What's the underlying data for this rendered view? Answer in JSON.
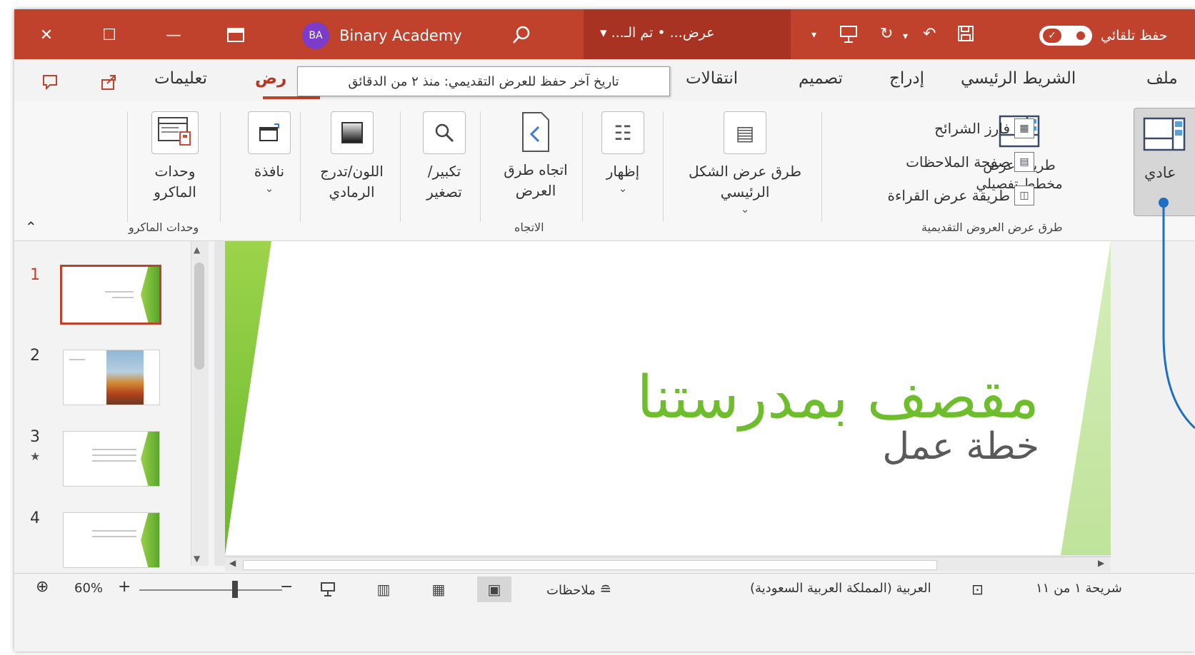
{
  "titlebar": {
    "account_initials": "BA",
    "account_name": "Binary Academy",
    "doc_title": "عرض... • تم الـ... ▾",
    "autosave_label": "حفظ تلقائي",
    "autosave_state": "on"
  },
  "tabs": [
    {
      "label": "ملف"
    },
    {
      "label": "الشريط الرئيسي"
    },
    {
      "label": "إدراج"
    },
    {
      "label": "تصميم"
    },
    {
      "label": "انتقالات"
    },
    {
      "label": "عرض",
      "visible_text": "رض"
    },
    {
      "label": "تعليمات"
    }
  ],
  "tooltip": "تاريخ آخر حفظ للعرض التقديمي: منذ ٢ من الدقائق",
  "ribbon": {
    "presentation_views": {
      "group_label": "طرق عرض العروض التقديمية",
      "normal": "عادي",
      "outline": "طريقة عرض مخطط تفصيلي",
      "slide_sorter": "فارز الشرائح",
      "notes_page": "صفحة الملاحظات",
      "reading_view": "طريقة عرض القراءة"
    },
    "master_views": "طرق عرض الشكل الرئيسي",
    "show": "إظهار",
    "direction": {
      "button": "اتجاه طرق العرض",
      "group_label": "الاتجاه"
    },
    "zoom": "تكبير/ تصغير",
    "color_grayscale": "اللون/تدرج الرمادي",
    "window": "نافذة",
    "macros": {
      "button": "وحدات الماكرو",
      "group_label": "وحدات الماكرو"
    }
  },
  "thumbnails": [
    {
      "num": "1",
      "selected": true
    },
    {
      "num": "2",
      "selected": false
    },
    {
      "num": "3",
      "selected": false,
      "has_animation": true
    },
    {
      "num": "4",
      "selected": false
    }
  ],
  "slide": {
    "title": "مقصف بمدرستنا",
    "subtitle": "خطة عمل"
  },
  "statusbar": {
    "slide_count": "شريحة ١ من ١١",
    "language": "العربية (المملكة العربية السعودية)",
    "notes": "ملاحظات",
    "zoom": "60%"
  },
  "colors": {
    "accent": "#c0412c",
    "slide_green": "#6ebd2c",
    "callout": "#1e6fc1"
  }
}
